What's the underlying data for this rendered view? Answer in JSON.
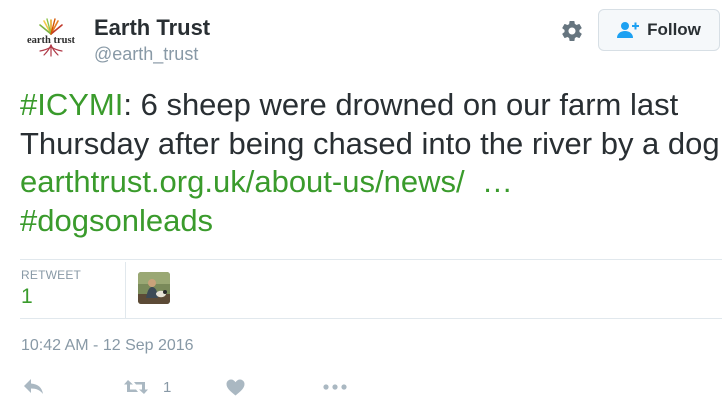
{
  "account": {
    "logo_text": "earth trust",
    "name": "Earth Trust",
    "handle": "@earth_trust"
  },
  "follow_button": {
    "label": "Follow"
  },
  "tweet": {
    "hashtag1": "#ICYMI",
    "text_main": ": 6 sheep were drowned on our farm last Thursday after being chased into the river by a dog ",
    "link": "earthtrust.org.uk/about-us/news/",
    "ellipsis": "…",
    "hashtag2": "#dogsonleads"
  },
  "stats": {
    "retweet_label": "RETWEET",
    "retweet_count": "1"
  },
  "timestamp": "10:42 AM - 12 Sep 2016",
  "actions": {
    "retweet_count": "1"
  },
  "colors": {
    "accent": "#3a9b2c",
    "muted": "#8899a6",
    "text": "#292f33"
  },
  "icons": [
    "gear-icon",
    "add-user-icon",
    "reply-icon",
    "retweet-icon",
    "like-icon",
    "more-icon"
  ]
}
